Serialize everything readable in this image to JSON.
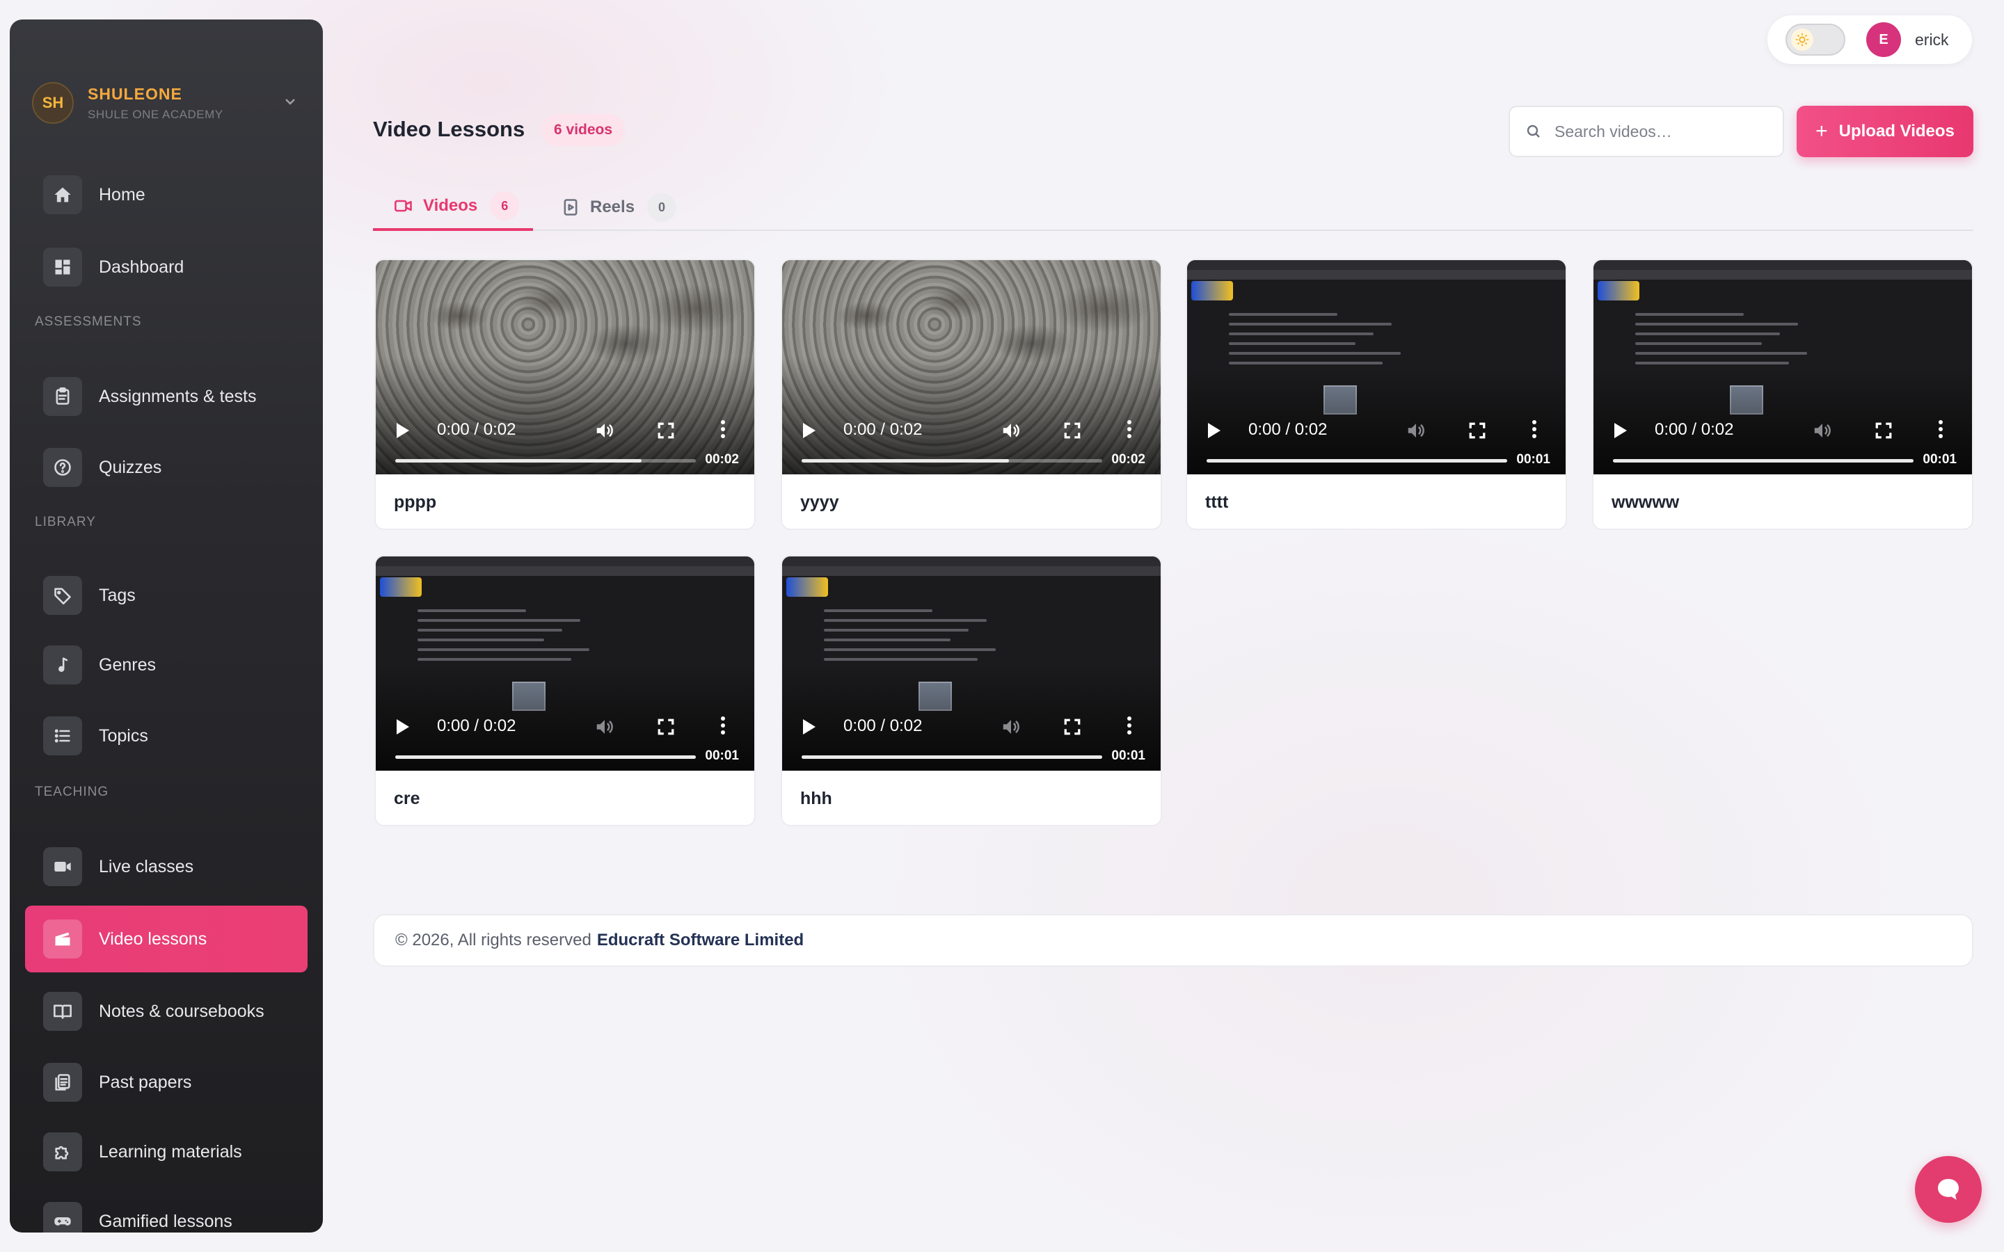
{
  "brand": {
    "initials": "SH",
    "name": "SHULEONE",
    "subtitle": "SHULE ONE ACADEMY"
  },
  "sidebar": {
    "top_items": [
      {
        "label": "Home",
        "icon": "home-icon"
      },
      {
        "label": "Dashboard",
        "icon": "dashboard-icon"
      }
    ],
    "sections": [
      {
        "title": "ASSESSMENTS",
        "items": [
          {
            "label": "Assignments & tests",
            "icon": "clipboard-icon"
          },
          {
            "label": "Quizzes",
            "icon": "question-icon"
          }
        ]
      },
      {
        "title": "LIBRARY",
        "items": [
          {
            "label": "Tags",
            "icon": "tag-icon"
          },
          {
            "label": "Genres",
            "icon": "music-note-icon"
          },
          {
            "label": "Topics",
            "icon": "list-icon"
          }
        ]
      },
      {
        "title": "TEACHING",
        "items": [
          {
            "label": "Live classes",
            "icon": "camera-icon"
          },
          {
            "label": "Video lessons",
            "icon": "clapperboard-icon",
            "active": true
          },
          {
            "label": "Notes & coursebooks",
            "icon": "book-icon"
          },
          {
            "label": "Past papers",
            "icon": "document-icon"
          },
          {
            "label": "Learning materials",
            "icon": "puzzle-icon"
          },
          {
            "label": "Gamified lessons",
            "icon": "gamepad-icon"
          }
        ]
      }
    ]
  },
  "user": {
    "initial": "E",
    "name": "erick"
  },
  "header": {
    "title": "Video Lessons",
    "count_badge": "6 videos",
    "search_placeholder": "Search videos…",
    "upload_label": "Upload Videos"
  },
  "tabs": [
    {
      "label": "Videos",
      "count": "6",
      "active": true,
      "icon": "video-camera-icon"
    },
    {
      "label": "Reels",
      "count": "0",
      "active": false,
      "icon": "reel-icon"
    }
  ],
  "videos": [
    {
      "title": "pppp",
      "time": "0:00 / 0:02",
      "duration": "00:02",
      "thumb": "nature",
      "progress": 0.82,
      "muted": false
    },
    {
      "title": "yyyy",
      "time": "0:00 / 0:02",
      "duration": "00:02",
      "thumb": "nature",
      "progress": 0.69,
      "muted": false
    },
    {
      "title": "tttt",
      "time": "0:00 / 0:02",
      "duration": "00:01",
      "thumb": "screen",
      "progress": 1.0,
      "muted": true
    },
    {
      "title": "wwwww",
      "time": "0:00 / 0:02",
      "duration": "00:01",
      "thumb": "screen",
      "progress": 1.0,
      "muted": true
    },
    {
      "title": "cre",
      "time": "0:00 / 0:02",
      "duration": "00:01",
      "thumb": "screen",
      "progress": 1.0,
      "muted": true
    },
    {
      "title": "hhh",
      "time": "0:00 / 0:02",
      "duration": "00:01",
      "thumb": "screen",
      "progress": 1.0,
      "muted": true
    }
  ],
  "footer": {
    "copyright": "© 2026, All rights reserved",
    "company": "Educraft Software Limited"
  },
  "colors": {
    "accent": "#e8386f",
    "brand": "#f6a93c",
    "sidebar": "#2a2a2e"
  }
}
